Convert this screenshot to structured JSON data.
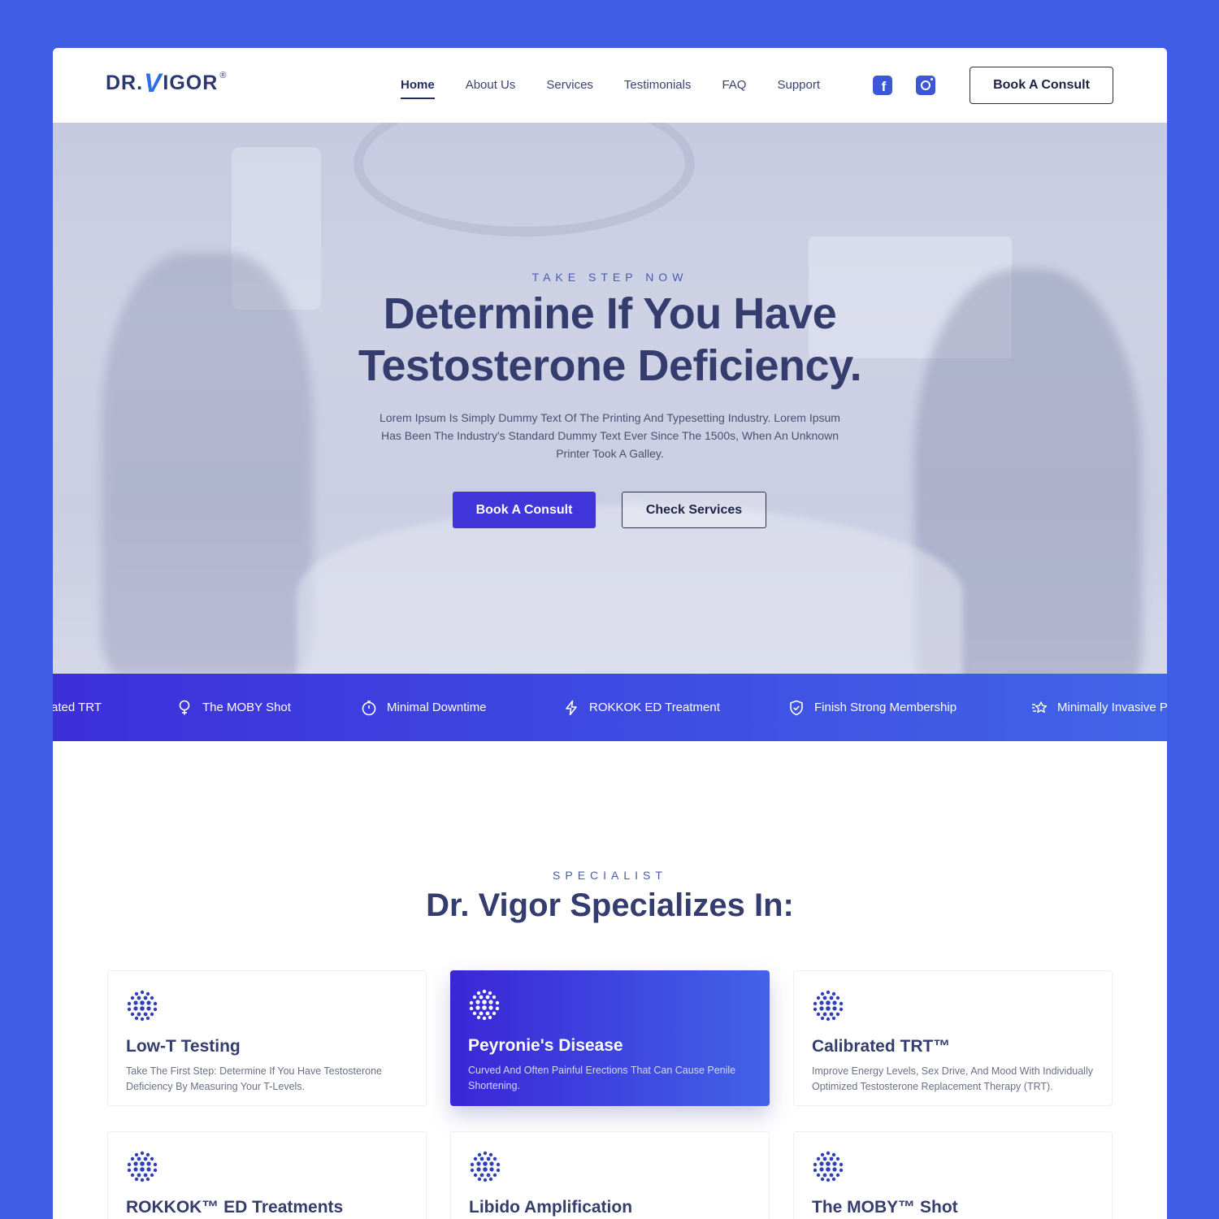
{
  "brand": {
    "logo_text_left": "DR.",
    "logo_text_v": "V",
    "logo_text_right": "IGOR",
    "logo_reg": "®"
  },
  "nav": {
    "items": [
      {
        "label": "Home",
        "active": true
      },
      {
        "label": "About Us",
        "active": false
      },
      {
        "label": "Services",
        "active": false
      },
      {
        "label": "Testimonials",
        "active": false
      },
      {
        "label": "FAQ",
        "active": false
      },
      {
        "label": "Support",
        "active": false
      }
    ],
    "social": [
      {
        "icon": "facebook-icon"
      },
      {
        "icon": "instagram-icon"
      }
    ],
    "cta_label": "Book A Consult"
  },
  "hero": {
    "eyebrow": "TAKE STEP NOW",
    "title_line1": "Determine If You Have",
    "title_line2": "Testosterone Deficiency.",
    "description": "Lorem Ipsum Is Simply Dummy Text Of The Printing And Typesetting Industry. Lorem Ipsum Has Been The Industry's Standard Dummy Text Ever Since The 1500s, When An Unknown Printer Took A Galley.",
    "primary_button": "Book A Consult",
    "secondary_button": "Check Services"
  },
  "band": {
    "items": [
      {
        "label": "ated TRT",
        "icon": ""
      },
      {
        "label": "The MOBY Shot",
        "icon": "female-symbol-icon"
      },
      {
        "label": "Minimal Downtime",
        "icon": "stopwatch-icon"
      },
      {
        "label": "ROKKOK ED Treatment",
        "icon": "lightning-icon"
      },
      {
        "label": "Finish Strong Membership",
        "icon": "shield-check-icon"
      },
      {
        "label": "Minimally Invasive Pr",
        "icon": "stars-icon"
      }
    ]
  },
  "specialist": {
    "eyebrow": "SPECIALIST",
    "title": "Dr. Vigor Specializes In:",
    "cards": [
      {
        "title": "Low-T Testing",
        "text": "Take The First Step: Determine If You Have Testosterone Deficiency By Measuring Your T-Levels.",
        "featured": false
      },
      {
        "title": "Peyronie's Disease",
        "text": "Curved And Often Painful Erections That Can Cause Penile Shortening.",
        "featured": true
      },
      {
        "title": "Calibrated TRT™",
        "text": "Improve Energy Levels, Sex Drive, And Mood With Individually Optimized Testosterone Replacement Therapy (TRT).",
        "featured": false
      },
      {
        "title": "ROKKOK™ ED Treatments",
        "text": "",
        "featured": false
      },
      {
        "title": "Libido Amplification",
        "text": "",
        "featured": false
      },
      {
        "title": "The MOBY™ Shot",
        "text": "",
        "featured": false
      }
    ]
  },
  "colors": {
    "background": "#405DE6",
    "primary": "#3F35D9",
    "heading": "#343D6E",
    "accent_text": "#4A5AA8"
  }
}
